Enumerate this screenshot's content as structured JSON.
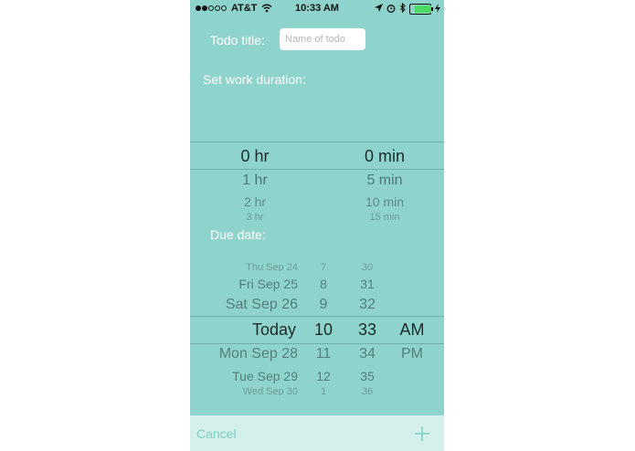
{
  "status_bar": {
    "carrier": "AT&T",
    "time": "10:33 AM"
  },
  "form": {
    "todo_title_label": "Todo title:",
    "todo_title_placeholder": "Name of todo",
    "todo_title_value": "",
    "work_duration_label": "Set work duration:",
    "due_date_label": "Due date:"
  },
  "duration_picker": {
    "hours": [
      "0 hr",
      "1 hr",
      "2 hr",
      "3 hr"
    ],
    "minutes": [
      "0 min",
      "5 min",
      "10 min",
      "15 min"
    ],
    "selected_hours": "0 hr",
    "selected_minutes": "0 min"
  },
  "date_picker": {
    "days": [
      "Thu Sep 24",
      "Fri Sep 25",
      "Sat Sep 26",
      "Today",
      "Mon Sep 28",
      "Tue Sep 29",
      "Wed Sep 30"
    ],
    "hours": [
      "7",
      "8",
      "9",
      "10",
      "11",
      "12",
      "1"
    ],
    "minutes": [
      "30",
      "31",
      "32",
      "33",
      "34",
      "35",
      "36"
    ],
    "ampm": [
      "AM",
      "PM"
    ],
    "selected": {
      "day": "Today",
      "hour": "10",
      "minute": "33",
      "ampm": "AM"
    }
  },
  "bottom_bar": {
    "cancel_label": "Cancel"
  },
  "colors": {
    "background": "#8ed4cc",
    "bottom_bar": "#d4efec",
    "accent": "#7fcfc5"
  },
  "icons": [
    "location-icon",
    "alarm-icon",
    "bluetooth-icon",
    "battery-icon",
    "wifi-icon",
    "plus-icon"
  ]
}
